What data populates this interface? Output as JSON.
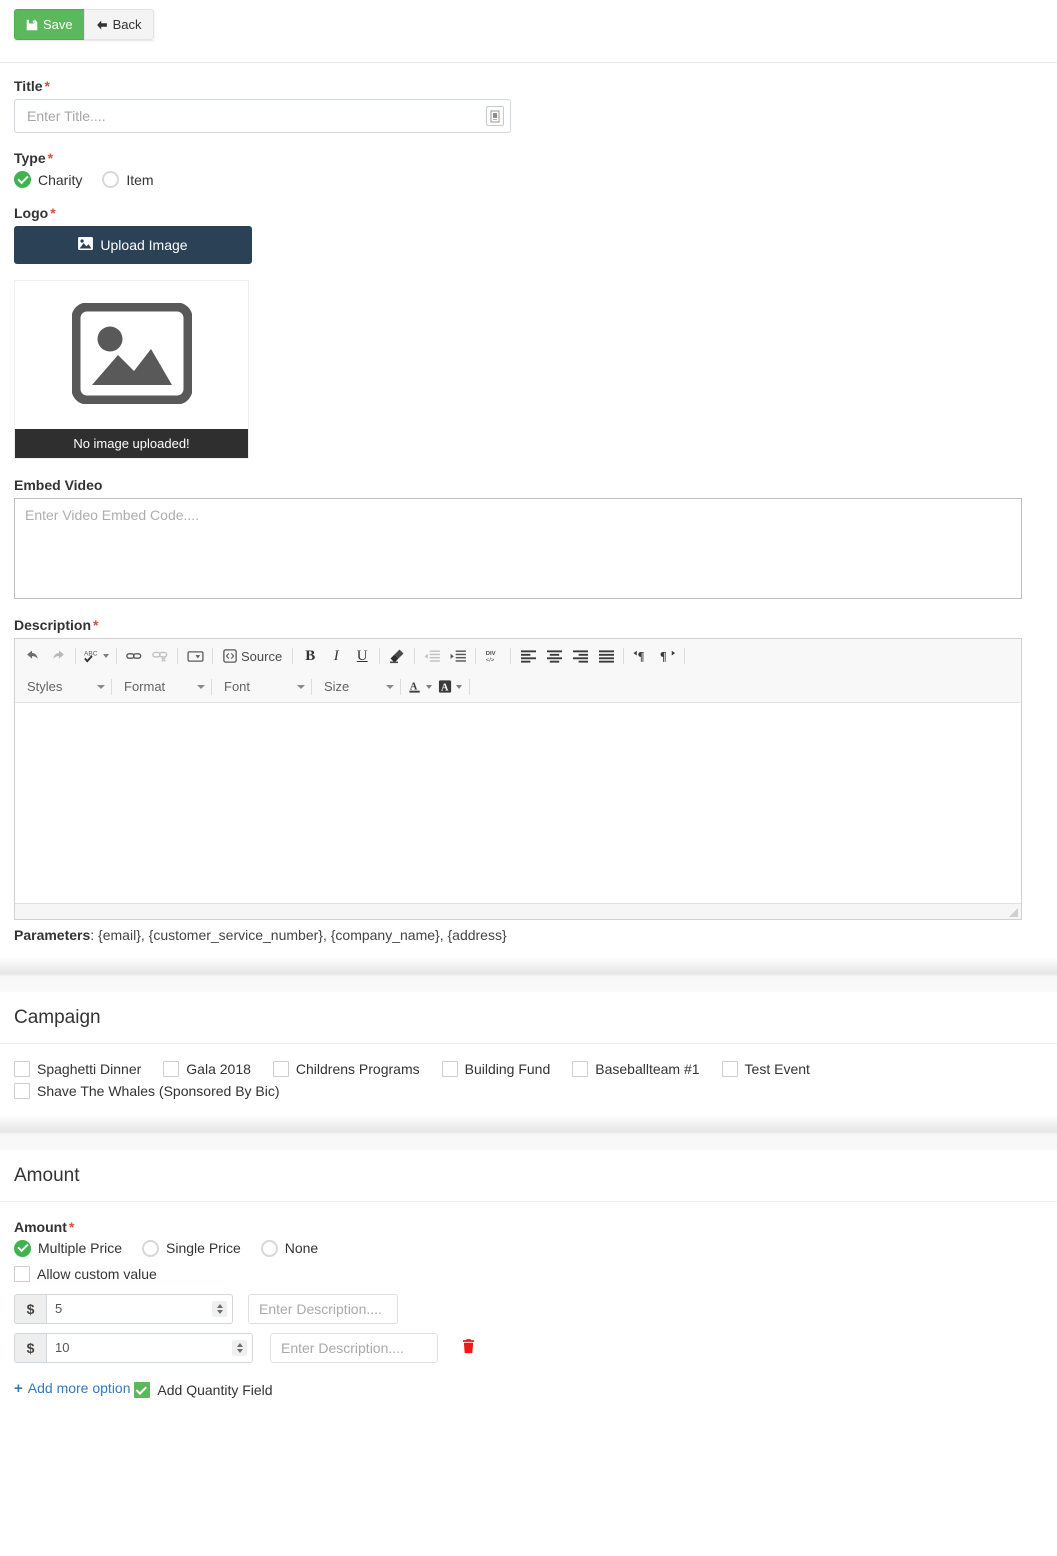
{
  "toolbar": {
    "save_label": "Save",
    "back_label": "Back",
    "save_icon": "floppy-disk-icon",
    "back_icon": "arrow-left-icon",
    "save_color": "#5cb85c"
  },
  "form": {
    "title": {
      "label": "Title",
      "required": "*",
      "placeholder": "Enter Title....",
      "value": ""
    },
    "type": {
      "label": "Type",
      "required": "*",
      "options": [
        {
          "label": "Charity",
          "selected": true
        },
        {
          "label": "Item",
          "selected": false
        }
      ]
    },
    "logo": {
      "label": "Logo",
      "required": "*",
      "upload_label": "Upload Image",
      "upload_icon": "image-icon",
      "no_image_caption": "No image uploaded!",
      "placeholder_icon": "image-placeholder-icon"
    },
    "embed_video": {
      "label": "Embed Video",
      "placeholder": "Enter Video Embed Code....",
      "value": ""
    },
    "description": {
      "label": "Description",
      "required": "*",
      "content": "",
      "parameters_label": "Parameters",
      "parameters_value": ": {email}, {customer_service_number}, {company_name}, {address}"
    }
  },
  "editor": {
    "row1": [
      {
        "name": "undo-icon",
        "type": "icon"
      },
      {
        "name": "redo-icon",
        "type": "icon"
      },
      {
        "name": "separator",
        "type": "sep"
      },
      {
        "name": "spellcheck-icon",
        "type": "icon",
        "caret": true
      },
      {
        "name": "separator",
        "type": "sep"
      },
      {
        "name": "link-icon",
        "type": "icon"
      },
      {
        "name": "unlink-icon",
        "type": "icon",
        "disabled": true
      },
      {
        "name": "separator",
        "type": "sep"
      },
      {
        "name": "flash-icon",
        "type": "icon"
      },
      {
        "name": "separator",
        "type": "sep"
      },
      {
        "name": "source-button",
        "type": "text",
        "label": "Source"
      },
      {
        "name": "separator",
        "type": "sep"
      },
      {
        "name": "bold-icon",
        "type": "icon",
        "label": "B"
      },
      {
        "name": "italic-icon",
        "type": "icon",
        "label": "I"
      },
      {
        "name": "underline-icon",
        "type": "icon",
        "label": "U"
      },
      {
        "name": "separator",
        "type": "sep"
      },
      {
        "name": "remove-format-icon",
        "type": "icon"
      },
      {
        "name": "separator",
        "type": "sep"
      },
      {
        "name": "outdent-icon",
        "type": "icon",
        "disabled": true
      },
      {
        "name": "indent-icon",
        "type": "icon"
      },
      {
        "name": "separator",
        "type": "sep"
      },
      {
        "name": "div-container-icon",
        "type": "icon"
      },
      {
        "name": "separator",
        "type": "sep"
      },
      {
        "name": "align-left-icon",
        "type": "icon"
      },
      {
        "name": "align-center-icon",
        "type": "icon"
      },
      {
        "name": "align-right-icon",
        "type": "icon"
      },
      {
        "name": "align-justify-icon",
        "type": "icon"
      },
      {
        "name": "separator",
        "type": "sep"
      },
      {
        "name": "ltr-icon",
        "type": "icon"
      },
      {
        "name": "rtl-icon",
        "type": "icon"
      },
      {
        "name": "separator",
        "type": "sep"
      }
    ],
    "combos": [
      {
        "name": "styles-combo",
        "label": "Styles"
      },
      {
        "name": "format-combo",
        "label": "Format"
      },
      {
        "name": "font-combo",
        "label": "Font"
      },
      {
        "name": "size-combo",
        "label": "Size"
      }
    ],
    "color_buttons": [
      {
        "name": "text-color-icon",
        "label": "A"
      },
      {
        "name": "bg-color-icon",
        "label": "A"
      }
    ]
  },
  "campaign": {
    "title": "Campaign",
    "items": [
      {
        "label": "Spaghetti Dinner",
        "checked": false
      },
      {
        "label": "Gala 2018",
        "checked": false
      },
      {
        "label": "Childrens Programs",
        "checked": false
      },
      {
        "label": "Building Fund",
        "checked": false
      },
      {
        "label": "Baseballteam #1",
        "checked": false
      },
      {
        "label": "Test Event",
        "checked": false
      },
      {
        "label": "Shave The Whales (Sponsored By Bic)",
        "checked": false
      }
    ]
  },
  "amount": {
    "title": "Amount",
    "field_label": "Amount",
    "required": "*",
    "modes": [
      {
        "label": "Multiple Price",
        "selected": true
      },
      {
        "label": "Single Price",
        "selected": false
      },
      {
        "label": "None",
        "selected": false
      }
    ],
    "allow_custom": {
      "label": "Allow custom value",
      "checked": false
    },
    "currency_symbol": "$",
    "rows": [
      {
        "value": "5",
        "description": "",
        "description_placeholder": "Enter Description....",
        "deletable": false
      },
      {
        "value": "10",
        "description": "",
        "description_placeholder": "Enter Description....",
        "deletable": true
      }
    ],
    "add_more_label": "Add more option",
    "add_more_icon": "plus-icon",
    "delete_icon": "trash-icon",
    "delete_color": "#f01818",
    "quantity": {
      "label": "Add Quantity Field",
      "checked": true
    }
  }
}
